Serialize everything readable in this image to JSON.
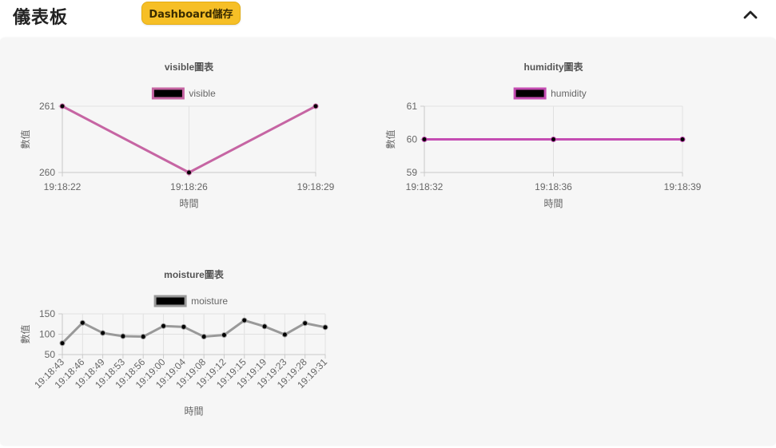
{
  "header": {
    "title": "儀表板",
    "save_label": "Dashboard儲存",
    "collapse_icon": "chevron-up-icon"
  },
  "colors": {
    "accent": "#f6bf26",
    "panel_bg": "#f6f6f6",
    "marker": "#000000"
  },
  "chart_data": [
    {
      "type": "line",
      "title": "visible圖表",
      "xlabel": "時間",
      "ylabel": "數值",
      "legend": "top-center",
      "grid": true,
      "x": [
        "19:18:22",
        "19:18:26",
        "19:18:29"
      ],
      "series": [
        {
          "name": "visible",
          "values": [
            261,
            260,
            261
          ],
          "color": "#c665a3"
        }
      ],
      "ylim": [
        260,
        261
      ],
      "yticks": [
        260,
        261
      ]
    },
    {
      "type": "line",
      "title": "humidity圖表",
      "xlabel": "時間",
      "ylabel": "數值",
      "legend": "top-center",
      "grid": true,
      "x": [
        "19:18:32",
        "19:18:36",
        "19:18:39"
      ],
      "series": [
        {
          "name": "humidity",
          "values": [
            60,
            60,
            60
          ],
          "color": "#c54db3"
        }
      ],
      "ylim": [
        59,
        61
      ],
      "yticks": [
        59,
        60,
        61
      ]
    },
    {
      "type": "line",
      "title": "moisture圖表",
      "xlabel": "時間",
      "ylabel": "數值",
      "legend": "top-center",
      "grid": true,
      "x": [
        "19:18:43",
        "19:18:46",
        "19:18:49",
        "19:18:53",
        "19:18:56",
        "19:19:00",
        "19:19:04",
        "19:19:08",
        "19:19:12",
        "19:19:15",
        "19:19:19",
        "19:19:23",
        "19:19:28",
        "19:19:31"
      ],
      "series": [
        {
          "name": "moisture",
          "values": [
            78,
            128,
            103,
            95,
            94,
            120,
            118,
            94,
            98,
            134,
            119,
            99,
            127,
            117
          ],
          "color": "#999999"
        }
      ],
      "ylim": [
        50,
        150
      ],
      "yticks": [
        50,
        100,
        150
      ]
    }
  ]
}
